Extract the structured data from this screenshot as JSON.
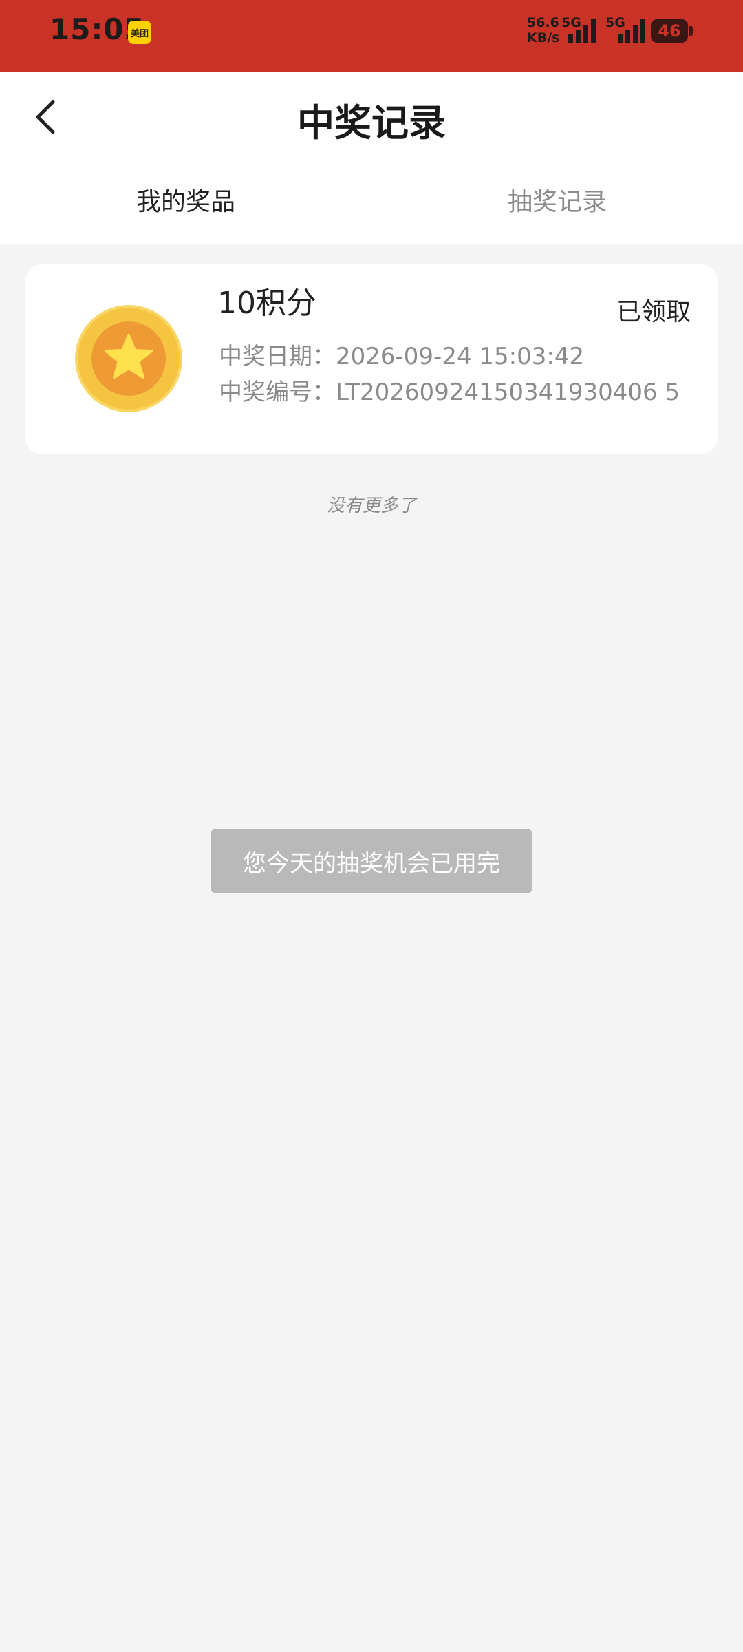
{
  "status_bar": {
    "time": "15:05",
    "app_badge": "美团",
    "net_speed_value": "56.6",
    "net_speed_unit": "KB/s",
    "net_type_1": "5G",
    "net_type_2": "5G",
    "battery": "46"
  },
  "header": {
    "title": "中奖记录",
    "tabs": [
      {
        "label": "我的奖品",
        "active": true
      },
      {
        "label": "抽奖记录",
        "active": false
      }
    ]
  },
  "prizes": [
    {
      "name": "10积分",
      "status": "已领取",
      "date_label": "中奖日期：",
      "date_value": "2026-09-24 15:03:42",
      "code_label": "中奖编号：",
      "code_value": "LT20260924150341930406 5",
      "icon": "gold-star-coin-icon"
    }
  ],
  "list_footer": "没有更多了",
  "toast": "您今天的抽奖机会已用完",
  "colors": {
    "status_bar_bg": "#c93226",
    "page_bg": "#f4f4f4",
    "coin_outer": "#f5c542",
    "coin_inner": "#ee9a35",
    "star": "#ffe14d"
  }
}
